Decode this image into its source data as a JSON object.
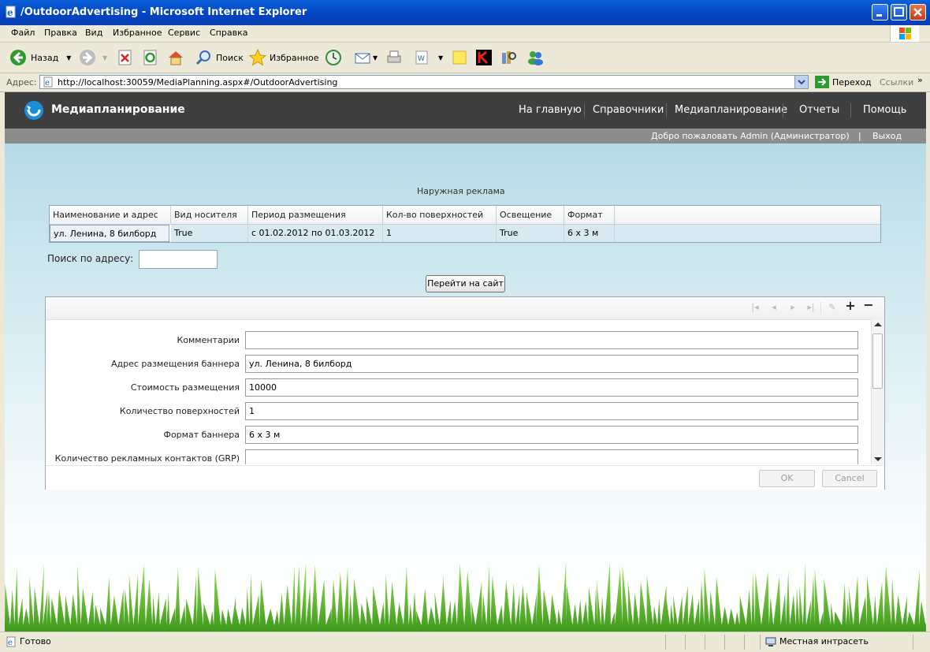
{
  "window": {
    "title": "/OutdoorAdvertising - Microsoft Internet Explorer"
  },
  "menu": [
    "Файл",
    "Правка",
    "Вид",
    "Избранное",
    "Сервис",
    "Справка"
  ],
  "toolbar": {
    "back_label": "Назад",
    "search_label": "Поиск",
    "favorites_label": "Избранное"
  },
  "address": {
    "label": "Адрес:",
    "url": "http://localhost:30059/MediaPlanning.aspx#/OutdoorAdvertising",
    "go_label": "Переход",
    "links_label": "Ссылки"
  },
  "site": {
    "title": "Медиапланирование",
    "nav": [
      "На главную",
      "Справочники",
      "Медиапланирование",
      "Отчеты",
      "Помощь"
    ],
    "welcome": "Добро пожаловать Admin (Администратор)",
    "separator": "|",
    "logout": "Выход"
  },
  "grid": {
    "caption": "Наружная реклама",
    "columns": [
      "Наименование и адрес",
      "Вид носителя",
      "Период размещения",
      "Кол-во поверхностей",
      "Освещение",
      "Формат"
    ],
    "rows": [
      [
        "ул. Ленина, 8 билборд",
        "True",
        "с 01.02.2012 по 01.03.2012",
        "1",
        "True",
        "6 х 3 м"
      ]
    ]
  },
  "search": {
    "label": "Поиск по адресу:",
    "value": ""
  },
  "goto_button": "Перейти на сайт",
  "form": {
    "fields": [
      {
        "label": "Комментарии",
        "value": ""
      },
      {
        "label": "Адрес размещения баннера",
        "value": "ул. Ленина, 8 билборд"
      },
      {
        "label": "Стоимость размещения",
        "value": "10000"
      },
      {
        "label": "Количество поверхностей",
        "value": "1"
      },
      {
        "label": "Формат баннера",
        "value": "6 х 3 м"
      },
      {
        "label": "Количество рекламных контактов (GRP)",
        "value": ""
      }
    ],
    "ok_label": "OK",
    "cancel_label": "Cancel"
  },
  "status": {
    "text": "Готово",
    "zone": "Местная интрасеть"
  },
  "colors": {
    "titlebar": "#0343c2",
    "site_header": "#3f3f3f",
    "site_subheader": "#8c8c8c",
    "selected_row": "#d8e9f1"
  }
}
